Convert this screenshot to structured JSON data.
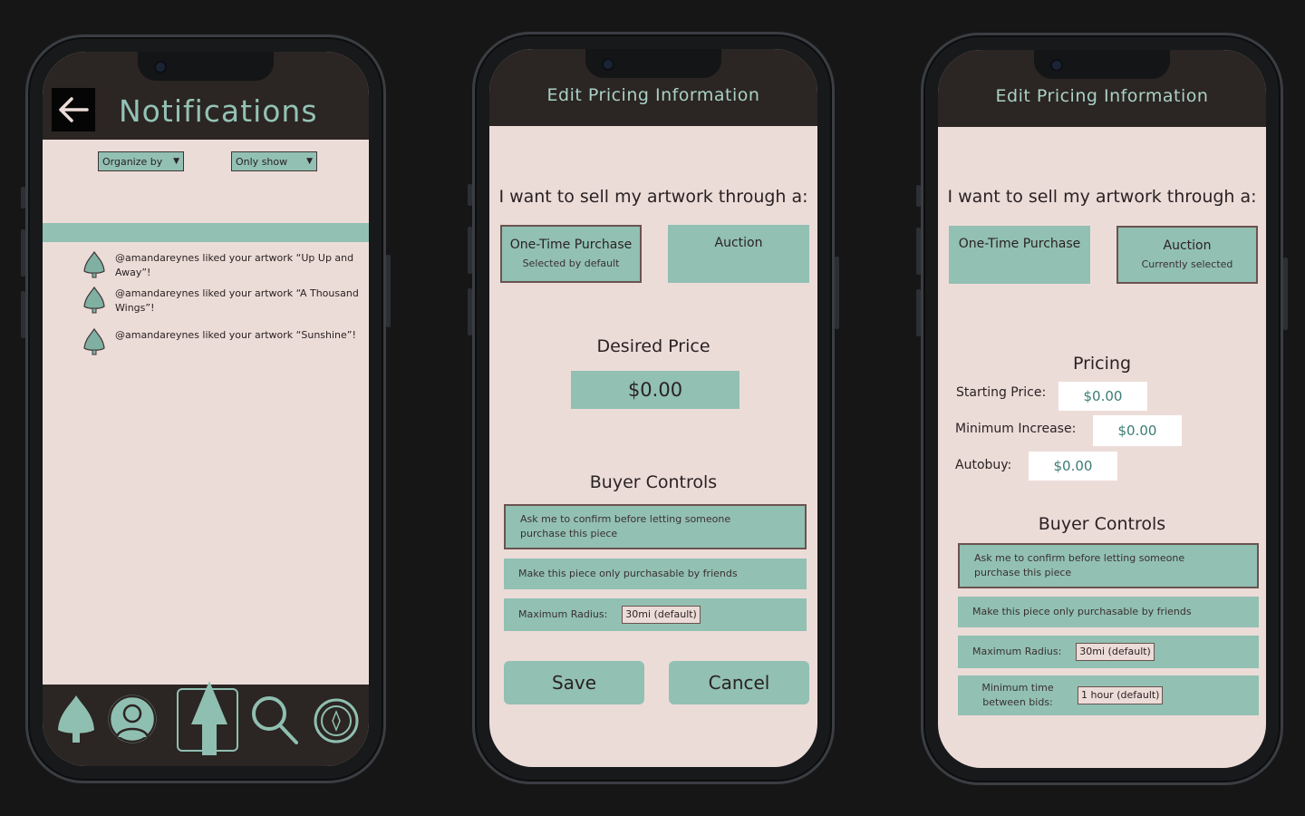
{
  "notifications_screen": {
    "title": "Notifications",
    "filters": {
      "organize_by": "Organize by",
      "only_show": "Only show"
    },
    "items": [
      {
        "text": "@amandareynes liked your artwork “Up Up and Away”!"
      },
      {
        "text": "@amandareynes liked your artwork “A Thousand Wings”!"
      },
      {
        "text": "@amandareynes liked your artwork “Sunshine”!"
      }
    ],
    "nav_icons": [
      "tree-icon",
      "profile-icon",
      "upload-tree-icon",
      "search-icon",
      "compass-icon"
    ]
  },
  "purchase_screen": {
    "header": "Edit Pricing Information",
    "question": "I want to sell my artwork through a:",
    "options": [
      {
        "label": "One-Time Purchase",
        "sub": "Selected by default",
        "selected": true
      },
      {
        "label": "Auction",
        "sub": "",
        "selected": false
      }
    ],
    "desired_price_title": "Desired Price",
    "desired_price_value": "$0.00",
    "buyer_controls_title": "Buyer Controls",
    "controls": {
      "confirm": "Ask me to confirm before letting someone purchase this piece",
      "friends": "Make this piece only purchasable by friends",
      "radius_label": "Maximum Radius:",
      "radius_value": "30mi (default)"
    },
    "save_label": "Save",
    "cancel_label": "Cancel"
  },
  "auction_screen": {
    "header": "Edit Pricing Information",
    "question": "I want to sell my artwork through a:",
    "options": [
      {
        "label": "One-Time Purchase",
        "sub": "",
        "selected": false
      },
      {
        "label": "Auction",
        "sub": "Currently selected",
        "selected": true
      }
    ],
    "pricing_title": "Pricing",
    "starting_price_label": "Starting Price:",
    "starting_price_value": "$0.00",
    "min_increase_label": "Minimum Increase:",
    "min_increase_value": "$0.00",
    "autobuy_label": "Autobuy:",
    "autobuy_value": "$0.00",
    "buyer_controls_title": "Buyer Controls",
    "controls": {
      "confirm": "Ask me to confirm before letting someone purchase this piece",
      "friends": "Make this piece only purchasable by friends",
      "radius_label": "Maximum Radius:",
      "radius_value": "30mi (default)",
      "min_time_label": "Minimum time between bids:",
      "min_time_value": "1 hour (default)"
    }
  },
  "colors": {
    "background": "#161616",
    "screen": "#ecdcd8",
    "header": "#2b2523",
    "accent": "#92c0b3",
    "title_text": "#93c2b5"
  }
}
